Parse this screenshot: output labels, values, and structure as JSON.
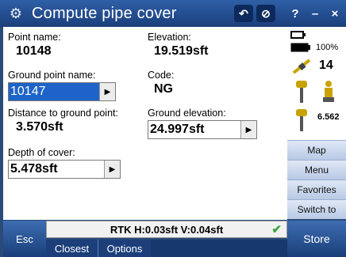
{
  "window": {
    "title": "Compute pipe cover",
    "app_icon": "gear-icon",
    "buttons": [
      "undo-icon",
      "disabled-icon"
    ],
    "help": "?",
    "minimize": "–",
    "close": "×"
  },
  "fields": {
    "point_name": {
      "label": "Point name:",
      "value": "10148"
    },
    "elevation": {
      "label": "Elevation:",
      "value": "19.519sft"
    },
    "ground_point_name": {
      "label": "Ground point name:",
      "value": "10147"
    },
    "code": {
      "label": "Code:",
      "value": "NG"
    },
    "distance_to_ground": {
      "label": "Distance to ground point:",
      "value": "3.570sft"
    },
    "ground_elevation": {
      "label": "Ground elevation:",
      "value": "24.997sft"
    },
    "depth_of_cover": {
      "label": "Depth of cover:",
      "value": "5.478sft"
    }
  },
  "status": {
    "battery_pct": "100%",
    "satellites": "14",
    "pdop": "6.562"
  },
  "side_menu": [
    "Map",
    "Menu",
    "Favorites",
    "Switch to"
  ],
  "status_line": "RTK H:0.03sft V:0.04sft",
  "softkeys": {
    "esc": "Esc",
    "closest": "Closest",
    "options": "Options",
    "store": "Store"
  }
}
